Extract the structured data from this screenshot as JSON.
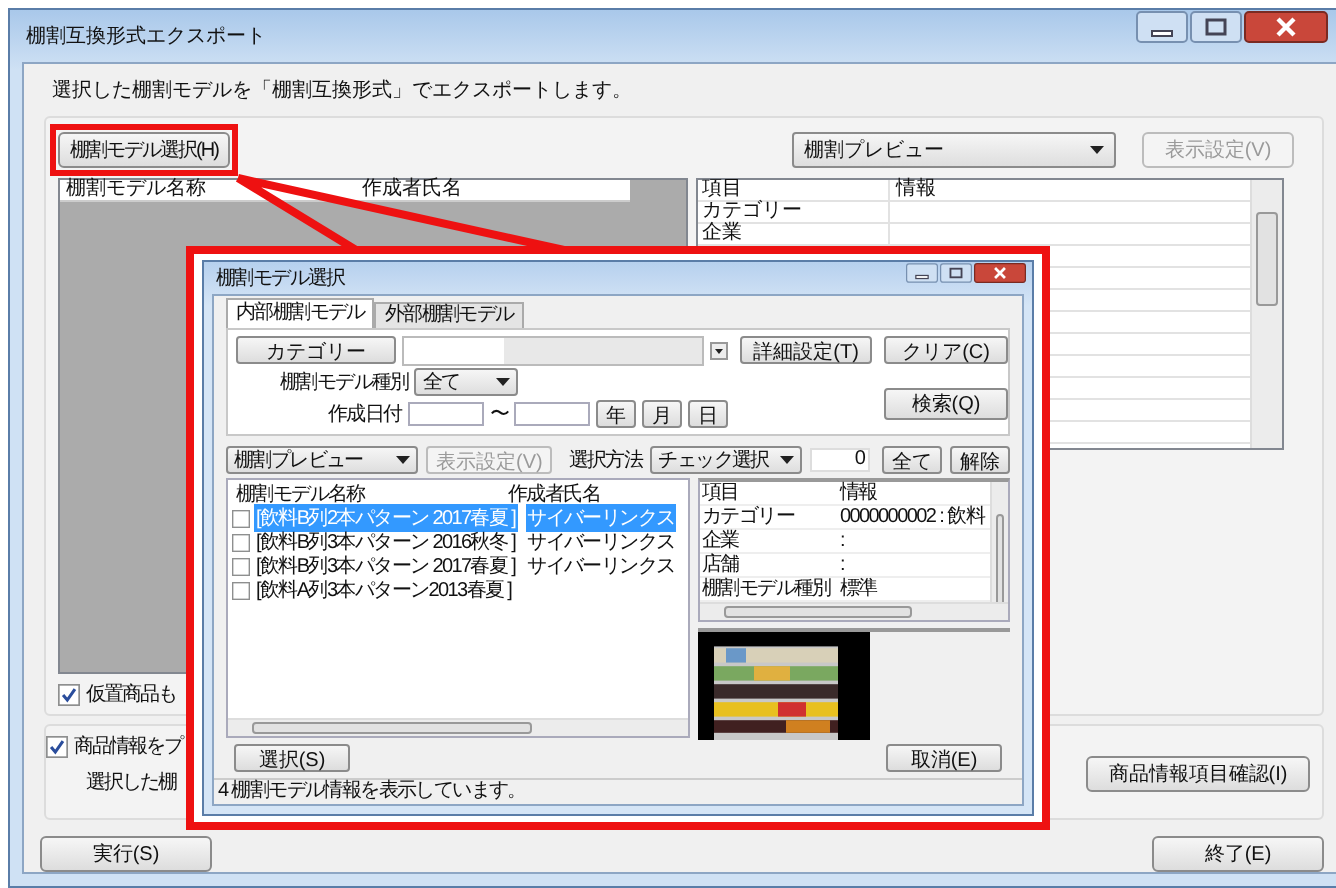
{
  "window": {
    "title": "棚割互換形式エクスポート"
  },
  "description": "選択した棚割モデルを「棚割互換形式」でエクスポートします。",
  "model_select_button": "棚割モデル選択(H)",
  "preview_select": {
    "value": "棚割プレビュー"
  },
  "display_settings_button": {
    "label": "表示設定(V)",
    "disabled": true
  },
  "model_list": {
    "columns": [
      "棚割モデル名称",
      "作成者氏名"
    ]
  },
  "info_grid": {
    "columns": [
      "項目",
      "情報"
    ],
    "rows": [
      {
        "item": "カテゴリー"
      },
      {
        "item": "企業"
      }
    ]
  },
  "temp_products_checkbox": {
    "label": "仮置商品も",
    "checked": true
  },
  "product_info_checkbox": {
    "label": "商品情報をプ",
    "checked": true
  },
  "product_info_note": "選択した棚",
  "product_info_button": "商品情報項目確認(I)",
  "footer_buttons": [
    "実行(S)",
    "終了(E)"
  ],
  "dialog": {
    "title": "棚割モデル選択",
    "tabs": [
      {
        "label": "内部棚割モデル",
        "selected": true
      },
      {
        "label": "外部棚割モデル",
        "selected": false
      }
    ],
    "category_button": "カテゴリー",
    "detail_button": "詳細設定(T)",
    "clear_button": "クリア(C)",
    "model_type": {
      "label": "棚割モデル種別",
      "value": "全て"
    },
    "created_date": {
      "label": "作成日付",
      "separator": "〜",
      "unit_buttons": [
        "年",
        "月",
        "日"
      ]
    },
    "search_button": "検索(Q)",
    "preview_select": {
      "value": "棚割プレビュー"
    },
    "display_settings_button": {
      "label": "表示設定(V)",
      "disabled": true
    },
    "selection_method": {
      "label": "選択方法",
      "value": "チェック選択",
      "count": "0"
    },
    "all_button": "全て",
    "clear_selection_button": "解除",
    "model_list": {
      "columns": [
        "棚割モデル名称",
        "作成者氏名"
      ],
      "rows": [
        {
          "name": "[飲料B列2本パターン 2017春夏 ]",
          "author": "サイバーリンクス",
          "checked": false,
          "selected": true
        },
        {
          "name": "[飲料B列3本パターン 2016秋冬 ]",
          "author": "サイバーリンクス",
          "checked": false,
          "selected": false
        },
        {
          "name": "[飲料B列3本パターン 2017春夏 ]",
          "author": "サイバーリンクス",
          "checked": false,
          "selected": false
        },
        {
          "name": "[飲料A列3本パターン2013春夏 ]",
          "checked": false,
          "selected": false
        }
      ]
    },
    "info_grid": {
      "columns": [
        "項目",
        "情報"
      ],
      "rows": [
        {
          "item": "カテゴリー",
          "info": "0000000002 : 飲料"
        },
        {
          "item": "企業",
          "info": ":"
        },
        {
          "item": "店舗",
          "info": ":"
        },
        {
          "item": "棚割モデル種別",
          "info": "標準"
        }
      ]
    },
    "select_button": "選択(S)",
    "cancel_button": "取消(E)",
    "status": "4 棚割モデル情報を表示しています。"
  }
}
